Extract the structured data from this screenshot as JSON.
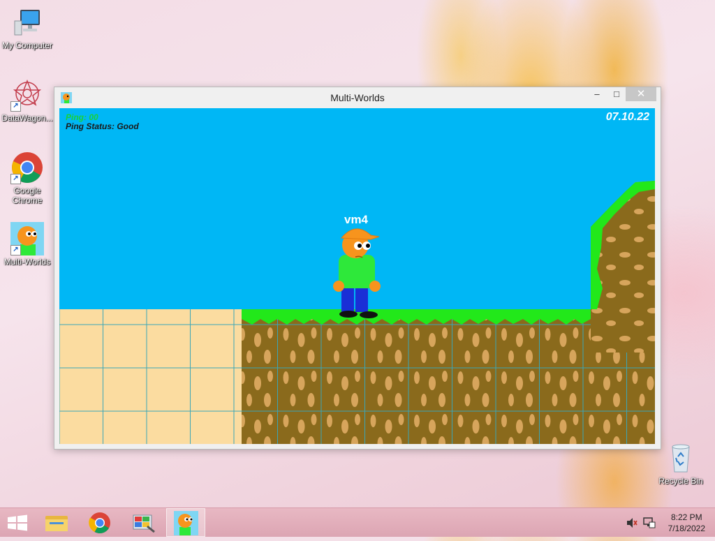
{
  "desktop": {
    "icons": [
      {
        "label": "My Computer"
      },
      {
        "label": "DataWagon..."
      },
      {
        "label": "Google Chrome"
      },
      {
        "label": "Multi-Worlds"
      },
      {
        "label": "Recycle Bin"
      }
    ]
  },
  "window": {
    "title": "Multi-Worlds",
    "minimize_glyph": "–",
    "maximize_glyph": "□",
    "close_glyph": "✕"
  },
  "game": {
    "ping_value": "Ping: 00",
    "ping_status": "Ping Status: Good",
    "date": "07.10.22",
    "player_name": "vm4",
    "colors": {
      "sky": "#00b7f5",
      "grass": "#22e81a",
      "dirt": "#8a6a1c",
      "sand": "#fbdca0"
    }
  },
  "taskbar": {
    "items": [
      "windows-start",
      "file-explorer",
      "google-chrome",
      "control-panel",
      "multi-worlds"
    ],
    "time": "8:22 PM",
    "date": "7/18/2022"
  }
}
